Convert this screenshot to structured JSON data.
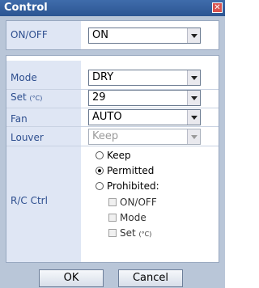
{
  "window": {
    "title": "Control",
    "close_symbol": "✕"
  },
  "power": {
    "label": "ON/OFF",
    "value": "ON"
  },
  "settings": {
    "mode": {
      "label": "Mode",
      "value": "DRY"
    },
    "set": {
      "label": "Set",
      "unit": "(°C)",
      "value": "29"
    },
    "fan": {
      "label": "Fan",
      "value": "AUTO"
    },
    "louver": {
      "label": "Louver",
      "value": "Keep",
      "disabled": true
    },
    "rc_ctrl": {
      "label": "R/C Ctrl",
      "options": [
        {
          "label": "Keep",
          "selected": false
        },
        {
          "label": "Permitted",
          "selected": true
        },
        {
          "label": "Prohibited:",
          "selected": false
        }
      ],
      "sub_options": [
        {
          "label": "ON/OFF",
          "checked": false
        },
        {
          "label": "Mode",
          "checked": false
        },
        {
          "label": "Set",
          "unit": "(°C)",
          "checked": false
        }
      ]
    }
  },
  "buttons": {
    "ok": "OK",
    "cancel": "Cancel"
  },
  "colors": {
    "titlebar": "#2c5592",
    "frame": "#b9c6d8",
    "label_bg": "#dfe6f4",
    "label_text": "#2e4f8f"
  }
}
